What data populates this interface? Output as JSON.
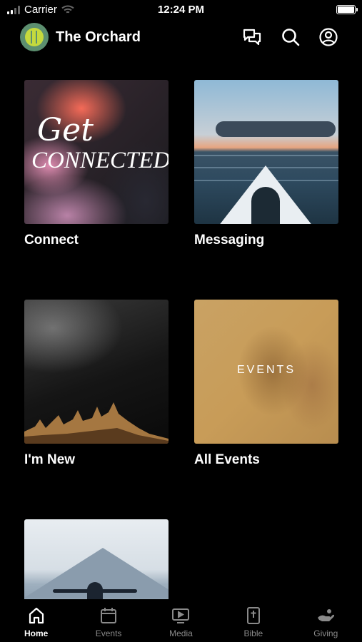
{
  "status_bar": {
    "carrier": "Carrier",
    "time": "12:24 PM"
  },
  "header": {
    "title": "The Orchard",
    "icons": [
      "messages-icon",
      "search-icon",
      "profile-icon"
    ]
  },
  "tiles": [
    {
      "label": "Connect",
      "image_text_1": "Get",
      "image_text_2": "CONNECTED"
    },
    {
      "label": "Messaging"
    },
    {
      "label": "I'm New"
    },
    {
      "label": "All Events",
      "image_text": "EVENTS"
    }
  ],
  "tab_bar": {
    "active": "Home",
    "items": [
      {
        "label": "Home",
        "icon": "home-icon"
      },
      {
        "label": "Events",
        "icon": "calendar-icon"
      },
      {
        "label": "Media",
        "icon": "tv-play-icon"
      },
      {
        "label": "Bible",
        "icon": "bible-icon"
      },
      {
        "label": "Giving",
        "icon": "giving-hand-icon"
      }
    ]
  },
  "colors": {
    "background": "#000000",
    "text": "#ffffff",
    "inactive_tab": "#8a8a8a",
    "logo_bg": "#5c8f6f",
    "logo_accent": "#c5d93d"
  }
}
